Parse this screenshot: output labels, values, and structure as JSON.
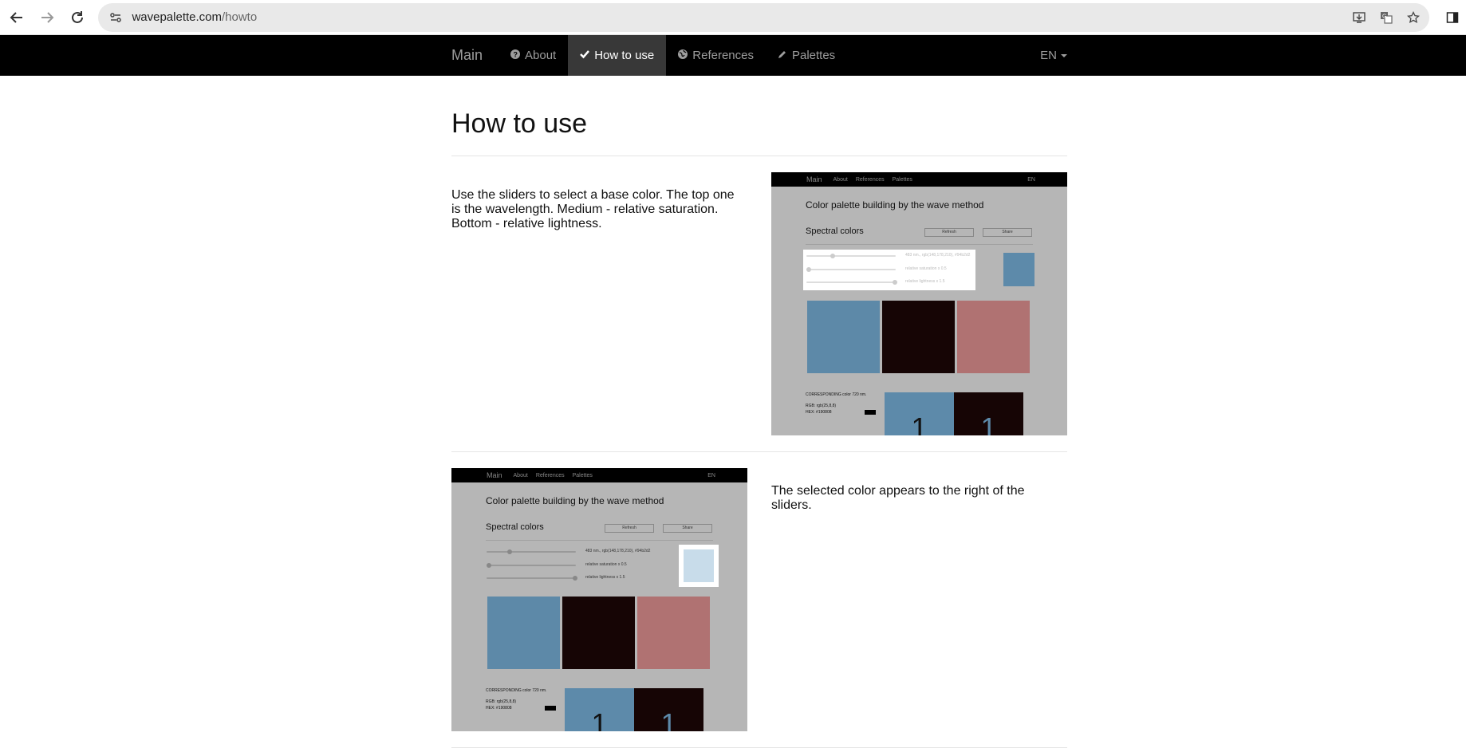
{
  "browser": {
    "url_domain": "wavepalette.com",
    "url_path": "/howto",
    "icons": [
      "back-icon",
      "forward-icon",
      "reload-icon",
      "site-info-icon",
      "install-icon",
      "translate-icon",
      "bookmark-star-icon",
      "side-panel-icon"
    ]
  },
  "navbar": {
    "brand": "Main",
    "items": [
      {
        "label": "About",
        "icon": "question-circle-icon",
        "active": false
      },
      {
        "label": "How to use",
        "icon": "check-icon",
        "active": true
      },
      {
        "label": "References",
        "icon": "globe-icon",
        "active": false
      },
      {
        "label": "Palettes",
        "icon": "pencil-icon",
        "active": false
      }
    ],
    "language": "EN"
  },
  "page": {
    "title": "How to use",
    "sections": [
      {
        "text": "Use the sliders to select a base color. The top one is the wavelength. Medium - relative saturation. Bottom - relative lightness.",
        "image_position": "right",
        "highlight": "sliders"
      },
      {
        "text": "The selected color appears to the right of the sliders.",
        "image_position": "left",
        "highlight": "swatch"
      }
    ]
  },
  "mini_screenshot": {
    "brand": "Main",
    "nav": [
      "About",
      "References",
      "Palettes"
    ],
    "lang": "EN",
    "title": "Color palette building by the wave method",
    "subtitle": "Spectral colors",
    "button1": "Refresh",
    "button2": "Share",
    "slider1_label": "483 nm., rgb(148,178,210), #94b2d2",
    "slider2_label": "relative saturation x 0.5",
    "slider3_label": "relative lightness x 1.5",
    "corr_line1": "CORRESPONDING color 720 nm.",
    "corr_line2": "RGB: rgb(25,8,8)",
    "corr_line3": "HEX: #190808",
    "block_digit": "1",
    "colors": {
      "selected_hl1": "#5d8aaa",
      "selected_hl2": "#c8dcea",
      "swatch1": "#5d89a8",
      "swatch2": "#160505",
      "swatch3": "#b07272",
      "block1": "#5d8aaa",
      "block2": "#160505"
    }
  }
}
